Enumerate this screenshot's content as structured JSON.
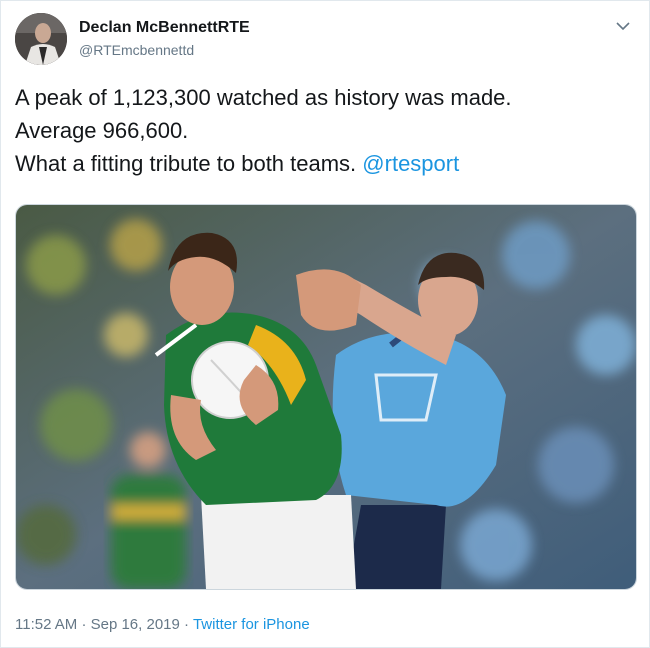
{
  "tweet": {
    "author_name": "Declan McBennettRTE",
    "author_handle": "@RTEmcbennettd",
    "text_line1": "A peak of 1,123,300 watched as history was made.",
    "text_line2": "Average 966,600.",
    "text_line3_prefix": "What a fitting tribute to both teams.",
    "mention": "@rtesport",
    "time": "11:52 AM",
    "separator1": "·",
    "date": "Sep 16, 2019",
    "separator2": "·",
    "source": "Twitter for iPhone",
    "menu_icon": "chevron-down-icon",
    "colors": {
      "link": "#1b95e0",
      "secondary_text": "#657786",
      "kerry_green": "#1f7a3a",
      "kerry_gold": "#e9b21b",
      "dublin_blue": "#5aa7dc",
      "dublin_navy": "#1c2a4a"
    }
  }
}
